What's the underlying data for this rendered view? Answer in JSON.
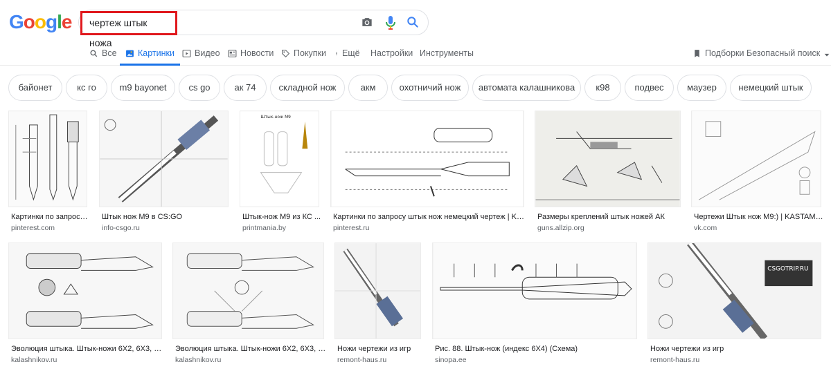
{
  "header": {
    "logo": [
      "G",
      "o",
      "o",
      "g",
      "l",
      "e"
    ],
    "logo_colors": [
      "#4285f4",
      "#ea4335",
      "#fbbc05",
      "#4285f4",
      "#34a853",
      "#ea4335"
    ],
    "search_query": "чертеж штык ножа"
  },
  "tabs": [
    {
      "label": "Все",
      "icon": "search-icon"
    },
    {
      "label": "Картинки",
      "icon": "image-icon",
      "active": true
    },
    {
      "label": "Видео",
      "icon": "play-icon"
    },
    {
      "label": "Новости",
      "icon": "news-icon"
    },
    {
      "label": "Покупки",
      "icon": "tag-icon"
    },
    {
      "label": "Ещё",
      "icon": "more-icon"
    },
    {
      "label": "Настройки"
    },
    {
      "label": "Инструменты"
    }
  ],
  "right_tools": {
    "collections": "Подборки",
    "safe_search": "Безопасный поиск"
  },
  "chips": [
    "байонет",
    "кс го",
    "m9 bayonet",
    "cs go",
    "ак 74",
    "складной нож",
    "акм",
    "охотничий нож",
    "автомата калашникова",
    "к98",
    "подвес",
    "маузер",
    "немецкий штык"
  ],
  "results": [
    {
      "title": "Картинки по запросу ...",
      "source": "pinterest.com"
    },
    {
      "title": "Штык нож M9 в CS:GO",
      "source": "info-csgo.ru"
    },
    {
      "title": "Штык-нож M9 из КС ...",
      "source": "printmania.by"
    },
    {
      "title": "Картинки по запросу штык нож немецкий чертеж | Knife ...",
      "source": "pinterest.ru"
    },
    {
      "title": "Размеры креплений штык ножей АК",
      "source": "guns.allzip.org"
    },
    {
      "title": "Чертежи Штык нож М9:) | KASTAME...",
      "source": "vk.com"
    },
    {
      "title": "Эволюция штыка. Штык-ножи 6Х2, 6Х3, 6Х4...",
      "source": "kalashnikov.ru"
    },
    {
      "title": "Эволюция штыка. Штык-ножи 6Х2, 6Х3, 6Х...",
      "source": "kalashnikov.ru"
    },
    {
      "title": "Ножи чертежи из игр",
      "source": "remont-haus.ru"
    },
    {
      "title": "Рис. 88. Штык-нож (индекс 6Х4) (Схема)",
      "source": "sinopa.ee"
    },
    {
      "title": "Ножи чертежи из игр",
      "source": "remont-haus.ru"
    }
  ],
  "thumb_labels": {
    "m9_title": "Штык-нож М9",
    "watermark": "CSGOTRIP.RU"
  },
  "colors": {
    "accent": "#1a73e8",
    "highlight": "#e0181d"
  }
}
